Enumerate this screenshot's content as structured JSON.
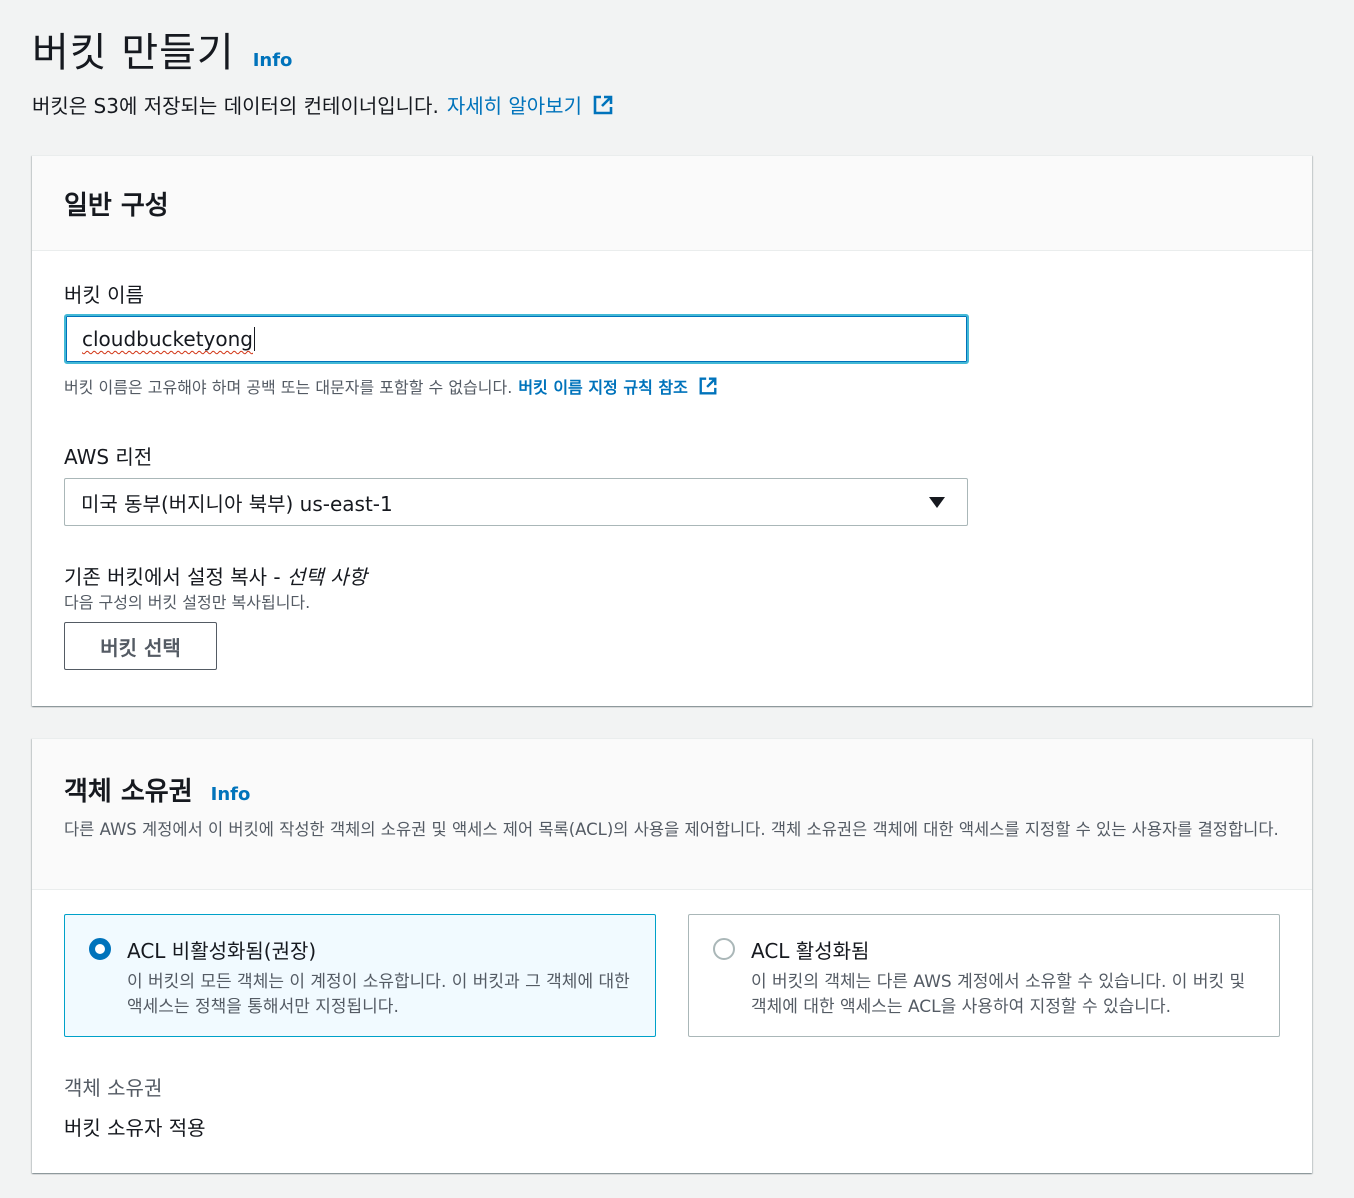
{
  "header": {
    "title": "버킷 만들기",
    "info": "Info",
    "description": "버킷은 S3에 저장되는 데이터의 컨테이너입니다.",
    "learn_more": "자세히 알아보기"
  },
  "general": {
    "title": "일반 구성",
    "bucket_name_label": "버킷 이름",
    "bucket_name_value": "cloudbucketyong",
    "bucket_name_hint": "버킷 이름은 고유해야 하며 공백 또는 대문자를 포함할 수 없습니다.",
    "bucket_name_rules_link": "버킷 이름 지정 규칙 참조",
    "region_label": "AWS 리전",
    "region_value": "미국 동부(버지니아 북부) us-east-1",
    "copy_label": "기존 버킷에서 설정 복사 -",
    "copy_optional": "선택 사항",
    "copy_hint": "다음 구성의 버킷 설정만 복사됩니다.",
    "choose_bucket_button": "버킷 선택"
  },
  "ownership": {
    "title": "객체 소유권",
    "info": "Info",
    "description": "다른 AWS 계정에서 이 버킷에 작성한 객체의 소유권 및 액세스 제어 목록(ACL)의 사용을 제어합니다. 객체 소유권은 객체에 대한 액세스를 지정할 수 있는 사용자를 결정합니다.",
    "option_disabled_title": "ACL 비활성화됨(권장)",
    "option_disabled_desc": "이 버킷의 모든 객체는 이 계정이 소유합니다. 이 버킷과 그 객체에 대한 액세스는 정책을 통해서만 지정됩니다.",
    "option_enabled_title": "ACL 활성화됨",
    "option_enabled_desc": "이 버킷의 객체는 다른 AWS 계정에서 소유할 수 있습니다. 이 버킷 및 객체에 대한 액세스는 ACL을 사용하여 지정할 수 있습니다.",
    "ownership_label": "객체 소유권",
    "ownership_value": "버킷 소유자 적용"
  },
  "colors": {
    "link": "#0073bb",
    "focus": "#44b9d6",
    "selected_bg": "#f1faff"
  }
}
